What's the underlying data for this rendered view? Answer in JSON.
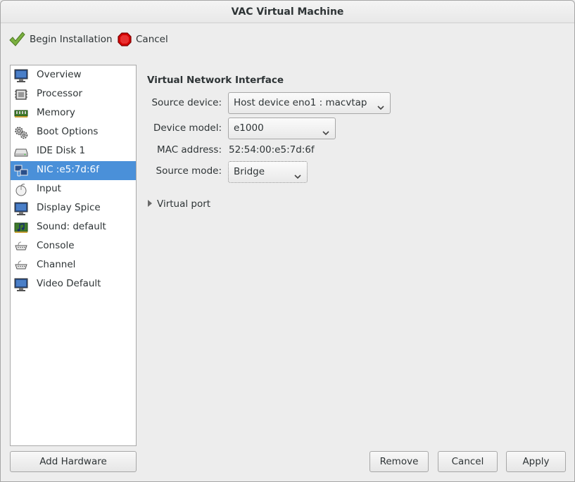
{
  "window": {
    "title": "VAC Virtual Machine"
  },
  "toolbar": {
    "begin_install_label": "Begin Installation",
    "cancel_label": "Cancel"
  },
  "sidebar": {
    "items": [
      {
        "label": "Overview",
        "icon": "monitor-icon"
      },
      {
        "label": "Processor",
        "icon": "cpu-chip-icon"
      },
      {
        "label": "Memory",
        "icon": "memory-icon"
      },
      {
        "label": "Boot Options",
        "icon": "gears-icon"
      },
      {
        "label": "IDE Disk 1",
        "icon": "hard-disk-icon"
      },
      {
        "label": "NIC :e5:7d:6f",
        "icon": "network-icon",
        "selected": true
      },
      {
        "label": "Input",
        "icon": "mouse-icon"
      },
      {
        "label": "Display Spice",
        "icon": "monitor-icon"
      },
      {
        "label": "Sound: default",
        "icon": "sound-card-icon"
      },
      {
        "label": "Console",
        "icon": "serial-port-icon"
      },
      {
        "label": "Channel",
        "icon": "serial-port-icon"
      },
      {
        "label": "Video Default",
        "icon": "monitor-icon"
      }
    ],
    "add_hardware_label": "Add Hardware"
  },
  "details": {
    "title": "Virtual Network Interface",
    "source_device_label": "Source device:",
    "source_device_value": "Host device eno1 : macvtap",
    "device_model_label": "Device model:",
    "device_model_value": "e1000",
    "mac_address_label": "MAC address:",
    "mac_address_value": "52:54:00:e5:7d:6f",
    "source_mode_label": "Source mode:",
    "source_mode_value": "Bridge",
    "virtual_port_label": "Virtual port"
  },
  "footer": {
    "remove_label": "Remove",
    "cancel_label": "Cancel",
    "apply_label": "Apply"
  },
  "colors": {
    "selection": "#4a90d9",
    "window_bg": "#ededed",
    "list_bg": "#ffffff"
  }
}
